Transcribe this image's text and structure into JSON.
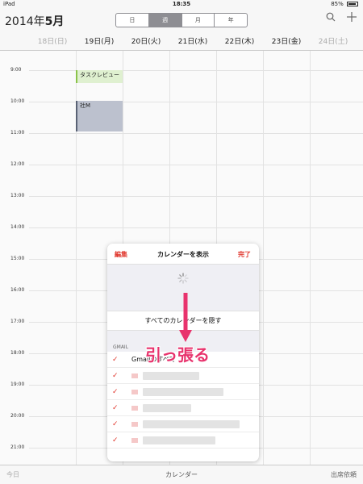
{
  "status": {
    "device": "iPad",
    "time": "18:35",
    "battery": "85%"
  },
  "nav": {
    "month_title_year": "2014年",
    "month_title_month": "5月",
    "segments": [
      "日",
      "週",
      "月",
      "年"
    ],
    "active_segment": 1
  },
  "days": [
    {
      "label": "18日(日)",
      "dim": true
    },
    {
      "label": "19日(月)",
      "dim": false
    },
    {
      "label": "20日(火)",
      "dim": false
    },
    {
      "label": "21日(水)",
      "dim": false
    },
    {
      "label": "22日(木)",
      "dim": false
    },
    {
      "label": "23日(金)",
      "dim": false
    },
    {
      "label": "24日(土)",
      "dim": true
    }
  ],
  "hours": [
    "9:00",
    "10:00",
    "11:00",
    "12:00",
    "13:00",
    "14:00",
    "15:00",
    "16:00",
    "17:00",
    "18:00",
    "19:00",
    "20:00",
    "21:00"
  ],
  "events": [
    {
      "title": "タスクレビュー",
      "color": "#8bc34a"
    },
    {
      "title": "社M",
      "color": "#5a6275"
    }
  ],
  "popover": {
    "edit": "編集",
    "title": "カレンダーを表示",
    "done": "完了",
    "hide_all": "すべてのカレンダーを隠す",
    "section": "GMAIL",
    "all_label": "Gmailのすべて"
  },
  "annotation": "引っ張る",
  "toolbar": {
    "today": "今日",
    "calendars": "カレンダー",
    "invites": "出席依頼"
  }
}
